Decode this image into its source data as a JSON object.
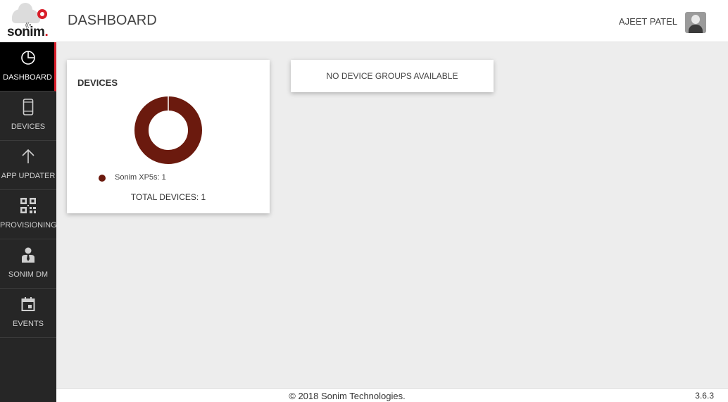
{
  "app": {
    "brand": "sonim"
  },
  "header": {
    "title": "DASHBOARD",
    "user_name": "AJEET PATEL"
  },
  "sidebar": {
    "items": [
      {
        "label": "DASHBOARD",
        "icon": "pie-chart-icon"
      },
      {
        "label": "DEVICES",
        "icon": "mobile-phone-icon"
      },
      {
        "label": "APP UPDATER",
        "icon": "arrow-up-icon"
      },
      {
        "label": "PROVISIONING",
        "icon": "qr-code-icon"
      },
      {
        "label": "SONIM DM",
        "icon": "user-tie-icon"
      },
      {
        "label": "EVENTS",
        "icon": "calendar-icon"
      }
    ]
  },
  "devices_card": {
    "title": "DEVICES",
    "legend": [
      {
        "label": "Sonim XP5s: 1",
        "color": "#6b1a0e"
      }
    ],
    "total": "TOTAL DEVICES: 1"
  },
  "groups_card": {
    "message": "NO DEVICE GROUPS AVAILABLE"
  },
  "footer": {
    "copyright": "© 2018 Sonim Technologies.",
    "version": "3.6.3"
  },
  "colors": {
    "accent": "#d81e2a",
    "sidebar_bg": "#262626",
    "donut": "#6b1a0e"
  }
}
